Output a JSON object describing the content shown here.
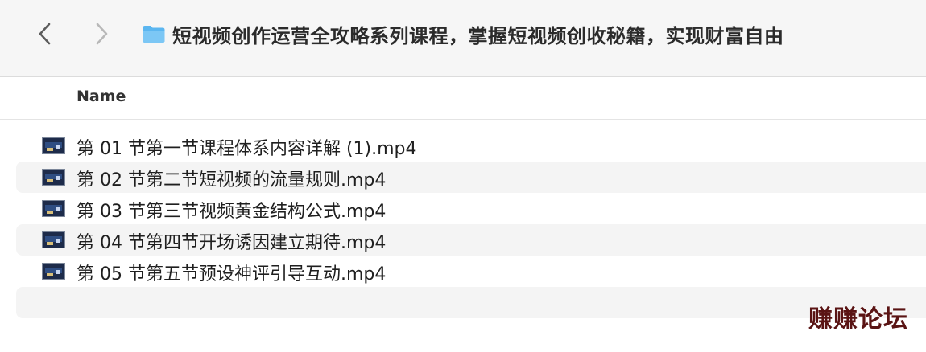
{
  "toolbar": {
    "back_icon": "chevron-left-icon",
    "forward_icon": "chevron-right-icon",
    "folder_icon": "folder-icon",
    "folder_color": "#5bb6f0",
    "title": "短视频创作运营全攻略系列课程，掌握短视频创收秘籍，实现财富自由"
  },
  "columns": {
    "name_label": "Name"
  },
  "files": [
    {
      "name": "第 01 节第一节课程体系内容详解 (1).mp4",
      "icon": "video-thumbnail-icon"
    },
    {
      "name": "第 02 节第二节短视频的流量规则.mp4",
      "icon": "video-thumbnail-icon"
    },
    {
      "name": "第 03 节第三节视频黄金结构公式.mp4",
      "icon": "video-thumbnail-icon"
    },
    {
      "name": "第 04 节第四节开场诱因建立期待.mp4",
      "icon": "video-thumbnail-icon"
    },
    {
      "name": "第 05 节第五节预设神评引导互动.mp4",
      "icon": "video-thumbnail-icon"
    }
  ],
  "watermark": {
    "text": "赚赚论坛"
  }
}
